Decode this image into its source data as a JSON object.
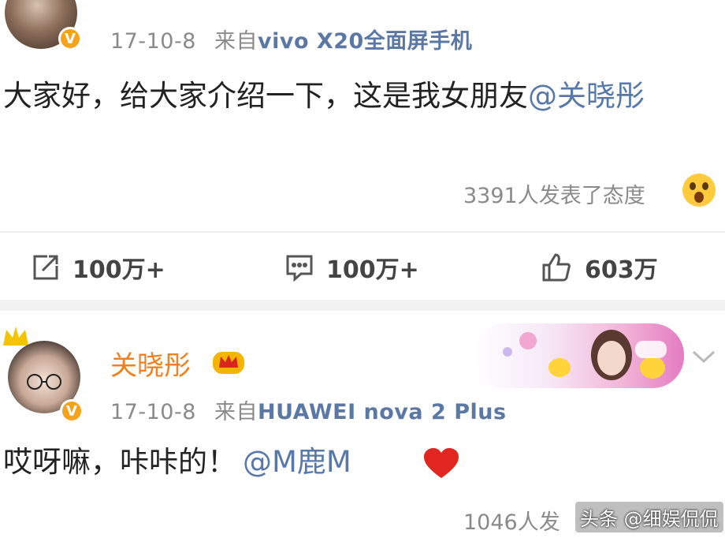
{
  "post1": {
    "date": "17-10-8",
    "source_prefix": "来自",
    "source_device": "vivo X20全面屏手机",
    "content_text": "大家好，给大家介绍一下，这是我女朋友",
    "mention": "@关晓彤",
    "reaction_count": "3391人发表了态度",
    "repost_count": "100万+",
    "comment_count": "100万+",
    "like_count": "603万"
  },
  "post2": {
    "username": "关晓彤",
    "date": "17-10-8",
    "source_prefix": "来自",
    "source_device": "HUAWEI nova 2 Plus",
    "content_text": "哎呀嘛，咔咔的！",
    "mention": "@M鹿M",
    "reaction_count": "1046人发",
    "verified_badge": "V"
  },
  "watermark": "头条 @细娱侃侃",
  "icons": {
    "repost": "repost-icon",
    "comment": "comment-icon",
    "like": "thumbs-up-icon",
    "surprised": "surprised-emoji-icon",
    "heart": "heart-icon",
    "crown": "crown-icon",
    "chevron": "chevron-down-icon"
  },
  "colors": {
    "meta_source": "#5b78a5",
    "mention": "#5778a8",
    "username": "#f08020",
    "verified": "#f7a21b",
    "heart": "#e0261f"
  }
}
